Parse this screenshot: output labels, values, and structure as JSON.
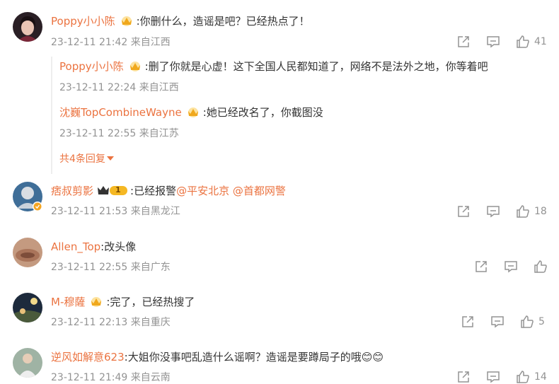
{
  "comments": [
    {
      "username": "Poppy小小陈",
      "text": ":你删什么，造谣是吧？已经热点了！",
      "meta": "23-12-11 21:42 来自江西",
      "likes": "41",
      "replies": [
        {
          "username": "Poppy小小陈",
          "text": ":删了你就是心虚！这下全国人民都知道了，网络不是法外之地，你等着吧",
          "meta": "23-12-11 22:24 来自江西"
        },
        {
          "username": "沈巍TopCombineWayne",
          "text": ":她已经改名了，你截图没",
          "meta": "23-12-11 22:55 来自江苏"
        }
      ],
      "more_label": "共4条回复"
    },
    {
      "username": "痞叔剪影",
      "level": "1",
      "text": ":已经报警",
      "mentions": [
        "@平安北京",
        "@首都网警"
      ],
      "meta": "23-12-11 21:53 来自黑龙江",
      "likes": "18"
    },
    {
      "username": "Allen_Top",
      "text": ":改头像",
      "meta": "23-12-11 22:55 来自广东",
      "likes": ""
    },
    {
      "username": "M-穆薩",
      "text": ":完了，已经热搜了",
      "meta": "23-12-11 22:13 来自重庆",
      "likes": "5"
    },
    {
      "username": "逆风如解意623",
      "text": ":大姐你没事吧乱造什么谣啊？造谣是要蹲局子的哦",
      "emoji": "😊😊",
      "meta": "23-12-11 21:49 来自云南",
      "likes": "14"
    }
  ],
  "colors": {
    "username": "#eb7340",
    "meta": "#939393",
    "text": "#333333"
  },
  "icons": [
    "share-icon",
    "comment-icon",
    "like-icon",
    "vip-crown-icon",
    "verified-icon"
  ]
}
